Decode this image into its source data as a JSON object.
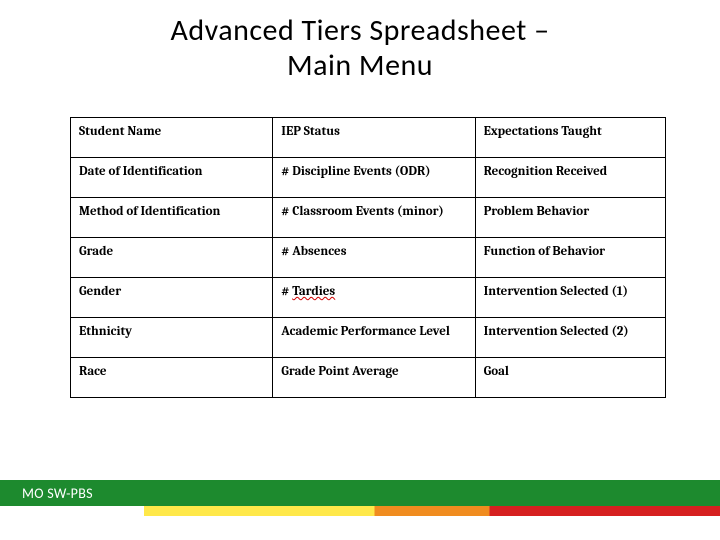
{
  "title_line1": "Advanced Tiers Spreadsheet –",
  "title_line2": "Main Menu",
  "table": {
    "rows": [
      [
        "Student Name",
        "IEP Status",
        "Expectations Taught"
      ],
      [
        "Date of Identification",
        "# Discipline Events (ODR)",
        "Recognition Received"
      ],
      [
        "Method of Identification",
        "# Classroom Events (minor)",
        "Problem Behavior"
      ],
      [
        "Grade",
        "# Absences",
        "Function of Behavior"
      ],
      [
        "Gender",
        "# Tardies",
        "Intervention Selected (1)"
      ],
      [
        "Ethnicity",
        "Academic Performance Level",
        "Intervention Selected (2)"
      ],
      [
        "Race",
        "Grade Point Average",
        "Goal"
      ]
    ]
  },
  "footer_label": "MO SW-PBS",
  "colors": {
    "green": "#1d8a2e",
    "yellow": "#ffe84a",
    "orange": "#f08c1f",
    "red": "#d62020"
  }
}
